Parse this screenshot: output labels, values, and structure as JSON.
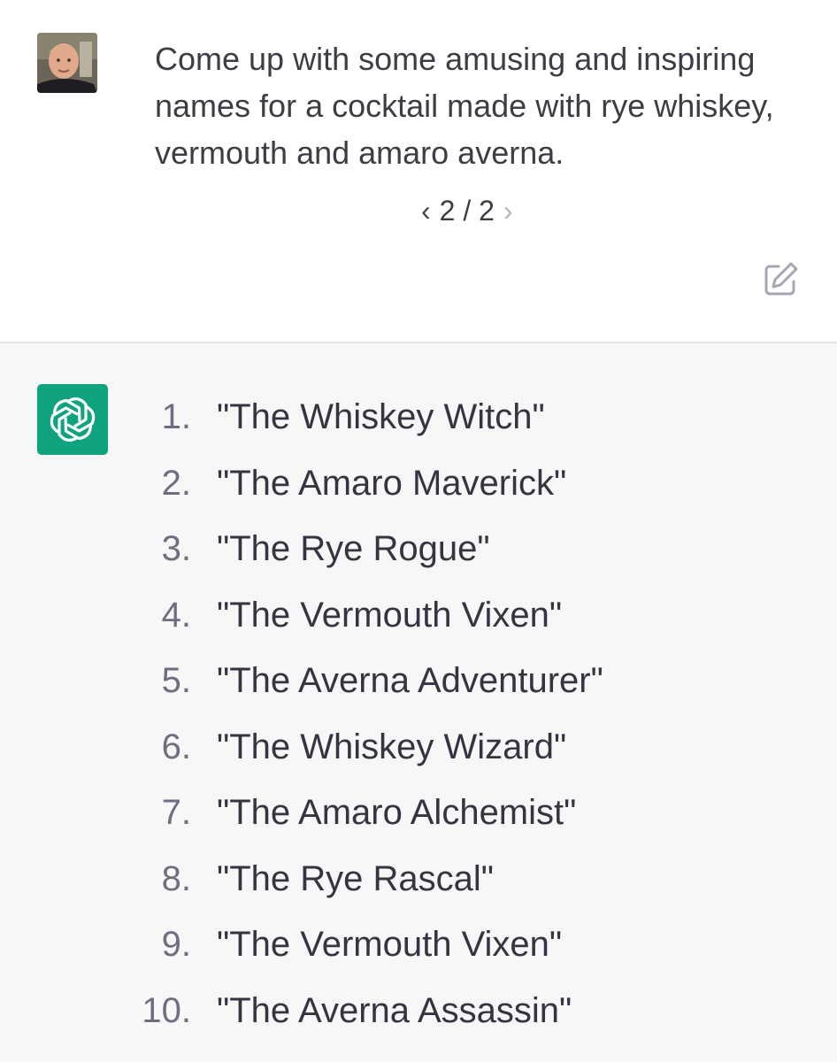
{
  "user_message": {
    "avatar": "user-avatar-photo",
    "text": "Come up with some amusing and inspiring names for a cocktail made with rye whiskey, vermouth and amaro averna.",
    "pager": {
      "prev_icon": "chevron-left-icon",
      "current": "2 / 2",
      "next_icon": "chevron-right-icon"
    },
    "edit_icon": "edit-icon"
  },
  "assistant_message": {
    "avatar": "openai-logo-icon",
    "accent_color": "#10a37f",
    "items": [
      {
        "num": "1.",
        "name": "\"The Whiskey Witch\""
      },
      {
        "num": "2.",
        "name": "\"The Amaro Maverick\""
      },
      {
        "num": "3.",
        "name": "\"The Rye Rogue\""
      },
      {
        "num": "4.",
        "name": "\"The Vermouth Vixen\""
      },
      {
        "num": "5.",
        "name": "\"The Averna Adventurer\""
      },
      {
        "num": "6.",
        "name": "\"The Whiskey Wizard\""
      },
      {
        "num": "7.",
        "name": "\"The Amaro Alchemist\""
      },
      {
        "num": "8.",
        "name": "\"The Rye Rascal\""
      },
      {
        "num": "9.",
        "name": "\"The Vermouth Vixen\""
      },
      {
        "num": "10.",
        "name": "\"The Averna Assassin\""
      }
    ]
  }
}
